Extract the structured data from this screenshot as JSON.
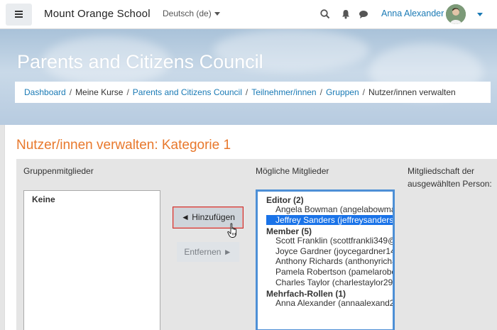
{
  "navbar": {
    "site_name": "Mount Orange School",
    "language": "Deutsch (de)",
    "user_name": "Anna Alexander",
    "icons": [
      "menu-icon",
      "search-icon",
      "bell-icon",
      "chat-icon"
    ]
  },
  "header": {
    "course_title": "Parents and Citizens Council",
    "breadcrumb": {
      "dashboard": "Dashboard",
      "my_courses": "Meine Kurse",
      "course": "Parents and Citizens Council",
      "participants": "Teilnehmer/innen",
      "groups": "Gruppen",
      "current": "Nutzer/innen verwalten"
    }
  },
  "main": {
    "heading": "Nutzer/innen verwalten: Kategorie 1",
    "group_members_label": "Gruppenmitglieder",
    "group_members": [
      "Keine"
    ],
    "potential_members_label": "Mögliche Mitglieder",
    "membership_label_line1": "Mitgliedschaft der",
    "membership_label_line2": "ausgewählten Person:",
    "add_button": "◄ Hinzufügen",
    "remove_button": "Entfernen ►",
    "potential_groups": [
      {
        "label": "Editor (2)",
        "users": [
          "Angela Bowman (angelabowma",
          "Jeffrey Sanders (jeffreysanders"
        ]
      },
      {
        "label": "Member (5)",
        "users": [
          "Scott Franklin (scottfrankli349@",
          "Joyce Gardner (joycegardner14",
          "Anthony Richards (anthonyricha",
          "Pamela Robertson (pamelarobe",
          "Charles Taylor (charlestaylor29"
        ]
      },
      {
        "label": "Mehrfach-Rollen (1)",
        "users": [
          "Anna Alexander (annaalexand2"
        ]
      }
    ],
    "selected_user": "Jeffrey Sanders (jeffreysanders"
  },
  "colors": {
    "accent_orange": "#e8782c",
    "link_blue": "#1a7ab5",
    "selection_blue": "#1a73e8"
  }
}
